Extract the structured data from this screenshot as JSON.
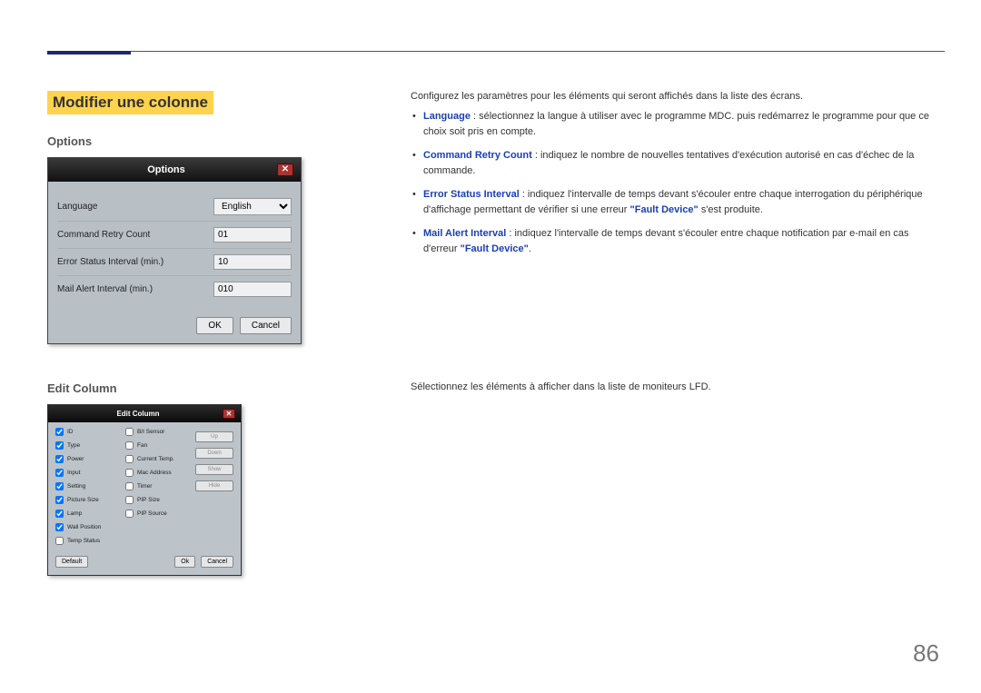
{
  "title_block": {
    "heading": "Modifier une colonne"
  },
  "options_section": {
    "subheading": "Options",
    "dialog_title": "Options",
    "rows": {
      "language_label": "Language",
      "language_value": "English",
      "retry_label": "Command Retry Count",
      "retry_value": "01",
      "error_label": "Error Status Interval (min.)",
      "error_value": "10",
      "mail_label": "Mail Alert Interval (min.)",
      "mail_value": "010"
    },
    "buttons": {
      "ok": "OK",
      "cancel": "Cancel"
    }
  },
  "options_desc": {
    "intro": "Configurez les paramètres pour les éléments qui seront affichés dans la liste des écrans.",
    "items": [
      {
        "term": "Language",
        "text": " : sélectionnez la langue à utiliser avec le programme MDC. puis redémarrez le programme pour que ce choix soit pris en compte."
      },
      {
        "term": "Command Retry Count",
        "text": " : indiquez le nombre de nouvelles tentatives d'exécution autorisé en cas d'échec de la commande."
      },
      {
        "term": "Error Status Interval",
        "text_before": " : indiquez l'intervalle de temps devant s'écouler entre chaque interrogation du périphérique d'affichage permettant de vérifier si une erreur ",
        "quoted": "\"Fault Device\"",
        "text_after": " s'est produite."
      },
      {
        "term": "Mail Alert Interval",
        "text_before": " : indiquez l'intervalle de temps devant s'écouler entre chaque notification par e-mail en cas d'erreur ",
        "quoted": "\"Fault Device\"",
        "text_after": "."
      }
    ]
  },
  "editcol_section": {
    "subheading": "Edit Column",
    "dialog_title": "Edit Column",
    "colA": [
      {
        "label": "ID",
        "checked": true
      },
      {
        "label": "Type",
        "checked": true
      },
      {
        "label": "Power",
        "checked": true
      },
      {
        "label": "Input",
        "checked": true
      },
      {
        "label": "Setting",
        "checked": true
      },
      {
        "label": "Picture Size",
        "checked": true
      },
      {
        "label": "Lamp",
        "checked": true
      },
      {
        "label": "Wall Position",
        "checked": true
      },
      {
        "label": "Temp Status",
        "checked": false
      }
    ],
    "colB": [
      {
        "label": "B/I Sensor",
        "checked": false
      },
      {
        "label": "Fan",
        "checked": false
      },
      {
        "label": "Current Temp.",
        "checked": false
      },
      {
        "label": "Mac Address",
        "checked": false
      },
      {
        "label": "Timer",
        "checked": false
      },
      {
        "label": "PIP Size",
        "checked": false
      },
      {
        "label": "PIP Source",
        "checked": false
      }
    ],
    "side_buttons": {
      "up": "Up",
      "down": "Down",
      "show": "Show",
      "hide": "Hide"
    },
    "footer": {
      "default": "Default",
      "ok": "Ok",
      "cancel": "Cancel"
    }
  },
  "editcol_desc": "Sélectionnez les éléments à afficher dans la liste de moniteurs LFD.",
  "page_number": "86"
}
